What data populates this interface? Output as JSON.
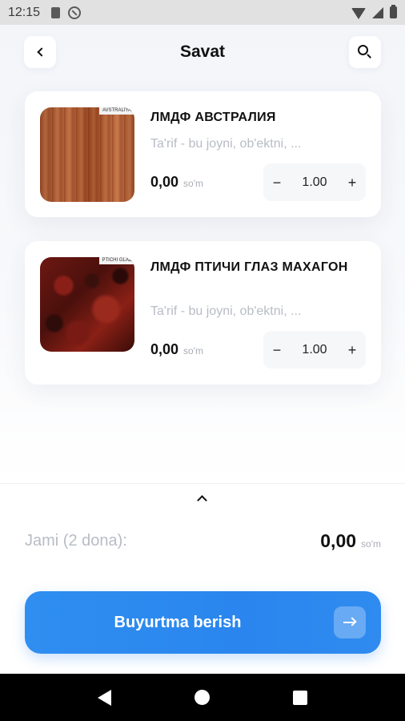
{
  "status_bar": {
    "time": "12:15",
    "icons": [
      "sim-card-icon",
      "do-not-disturb-icon",
      "wifi-icon",
      "signal-icon",
      "battery-icon"
    ]
  },
  "header": {
    "title": "Savat",
    "back_icon": "chevron-left-icon",
    "search_icon": "search-icon"
  },
  "cart": {
    "items": [
      {
        "name": "ЛМДФ АВСТРАЛИЯ",
        "image_label": "AVSTRALIYA",
        "description": "Ta'rif - bu joyni, ob'ektni, ...",
        "price": "0,00",
        "currency": "so'm",
        "quantity": "1.00",
        "minus": "−",
        "plus": "+"
      },
      {
        "name": "ЛМДФ ПТИЧИ ГЛАЗ МАХАГОН",
        "image_label": "PTICHI GLAZ",
        "description": "Ta'rif - bu joyni, ob'ektni, ...",
        "price": "0,00",
        "currency": "so'm",
        "quantity": "1.00",
        "minus": "−",
        "plus": "+"
      }
    ]
  },
  "summary": {
    "total_label": "Jami (2 dona):",
    "total_amount": "0,00",
    "currency": "so'm",
    "collapse_icon": "chevron-up-icon"
  },
  "order_button": {
    "label": "Buyurtma berish",
    "icon": "arrow-right-icon",
    "color": "#2a86ee"
  },
  "nav_bar": {
    "icons": [
      "back-triangle-icon",
      "home-circle-icon",
      "recents-square-icon"
    ]
  }
}
